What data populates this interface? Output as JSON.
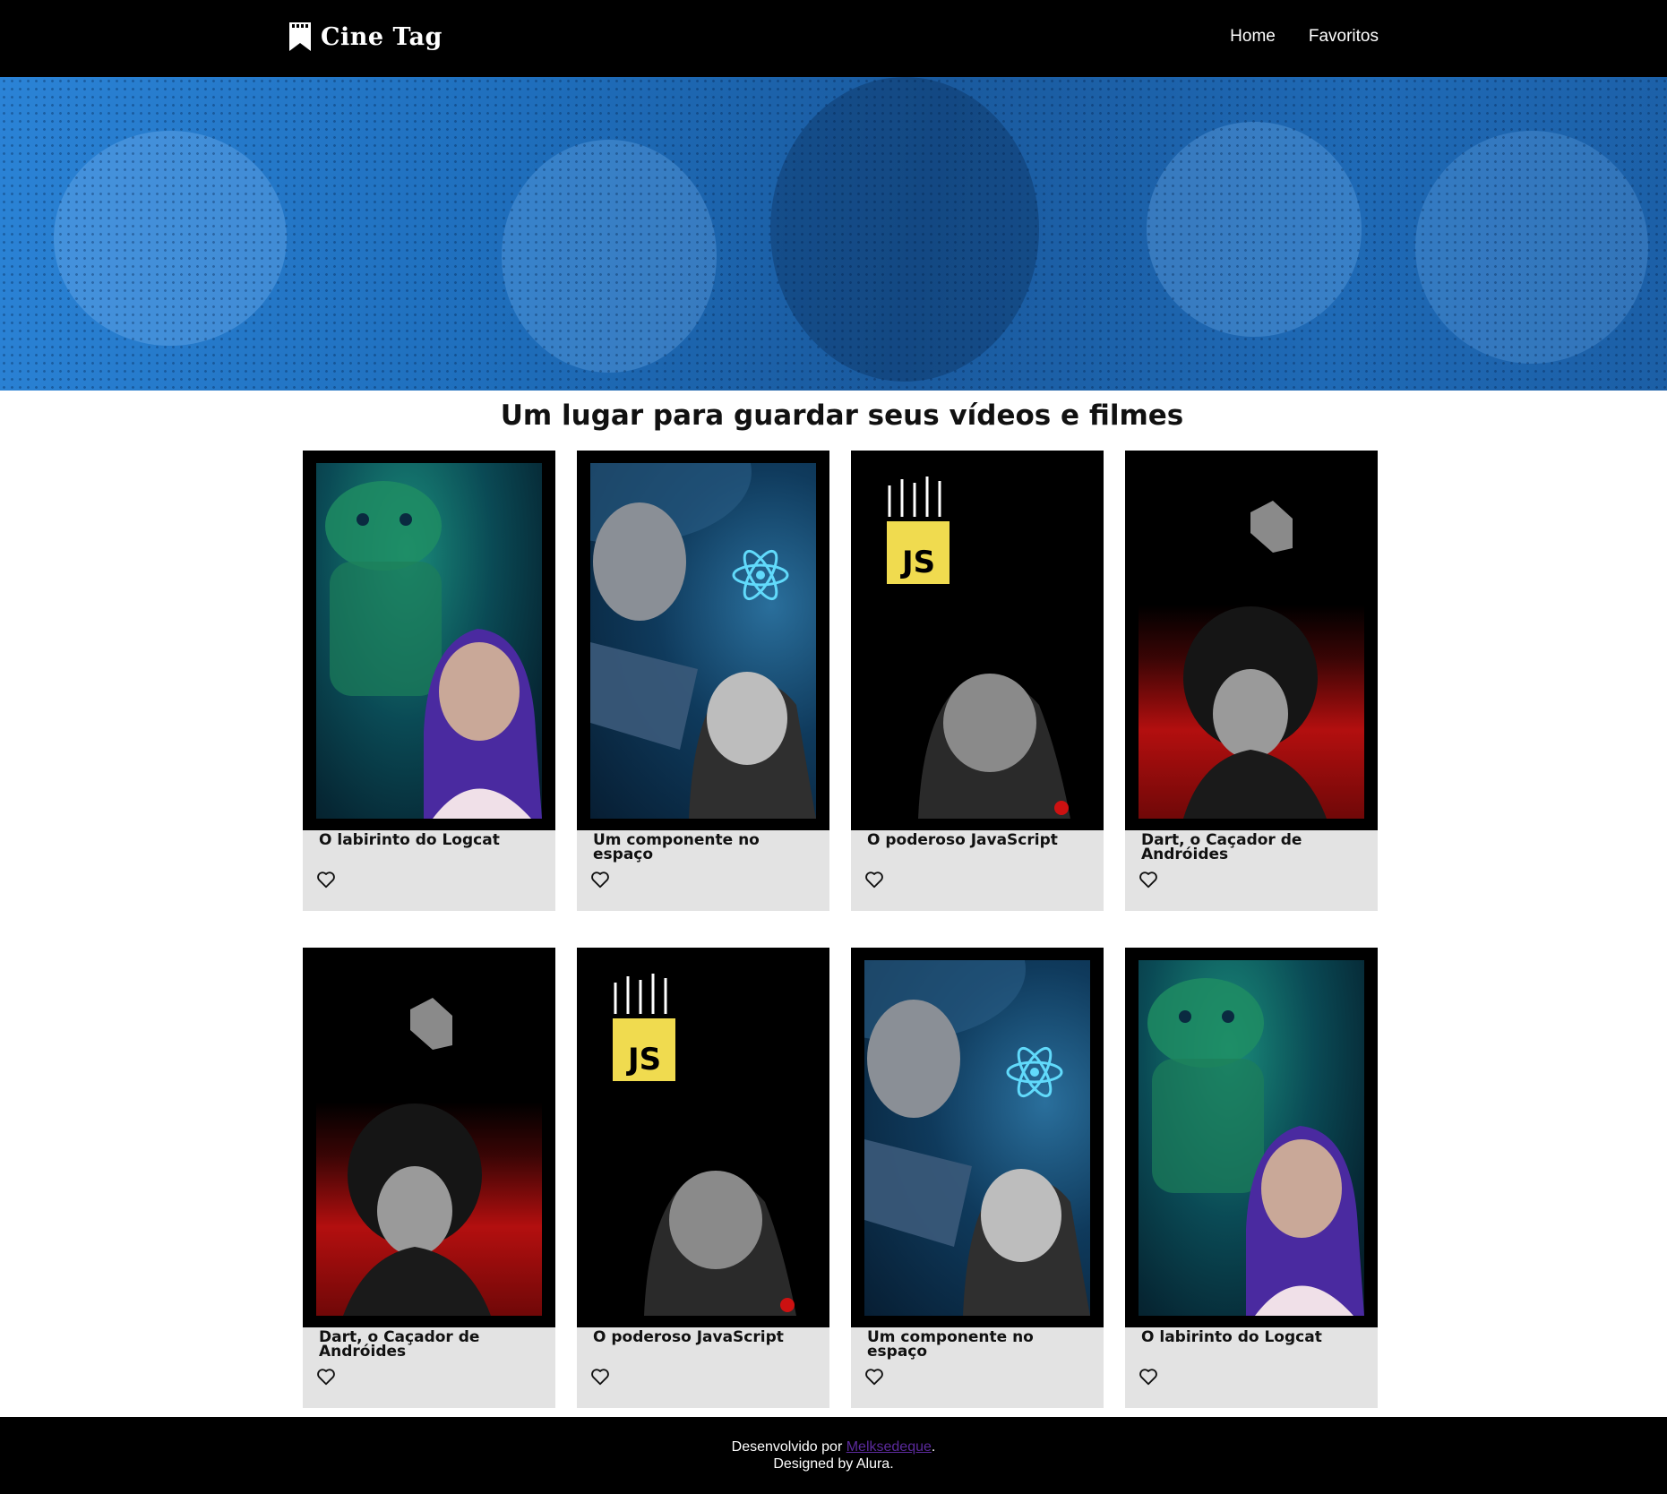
{
  "header": {
    "brand": "Cine Tag",
    "nav": [
      "Home",
      "Favoritos"
    ]
  },
  "main": {
    "title": "Um lugar para guardar seus vídeos e filmes",
    "cards": [
      {
        "title": "O labirinto do Logcat",
        "theme": "android"
      },
      {
        "title": "Um componente no espaço",
        "theme": "space"
      },
      {
        "title": "O poderoso JavaScript",
        "theme": "js"
      },
      {
        "title": "Dart, o Caçador de Andróides",
        "theme": "dart"
      },
      {
        "title": "Dart, o Caçador de Andróides",
        "theme": "dart"
      },
      {
        "title": "O poderoso JavaScript",
        "theme": "js"
      },
      {
        "title": "Um componente no espaço",
        "theme": "space"
      },
      {
        "title": "O labirinto do Logcat",
        "theme": "android"
      }
    ]
  },
  "footer": {
    "prefix": "Desenvolvido por",
    "author": "Melksedeque",
    "suffix": ".",
    "designed": "Designed by Alura."
  },
  "icons": {
    "logo": "bookmark-icon",
    "favorite": "heart-outline-icon"
  },
  "colors": {
    "header_bg": "#000000",
    "banner_blue": "#2b83d6",
    "card_bg": "#e3e3e3",
    "js_yellow": "#f0db4f",
    "react_cyan": "#61dafb"
  }
}
